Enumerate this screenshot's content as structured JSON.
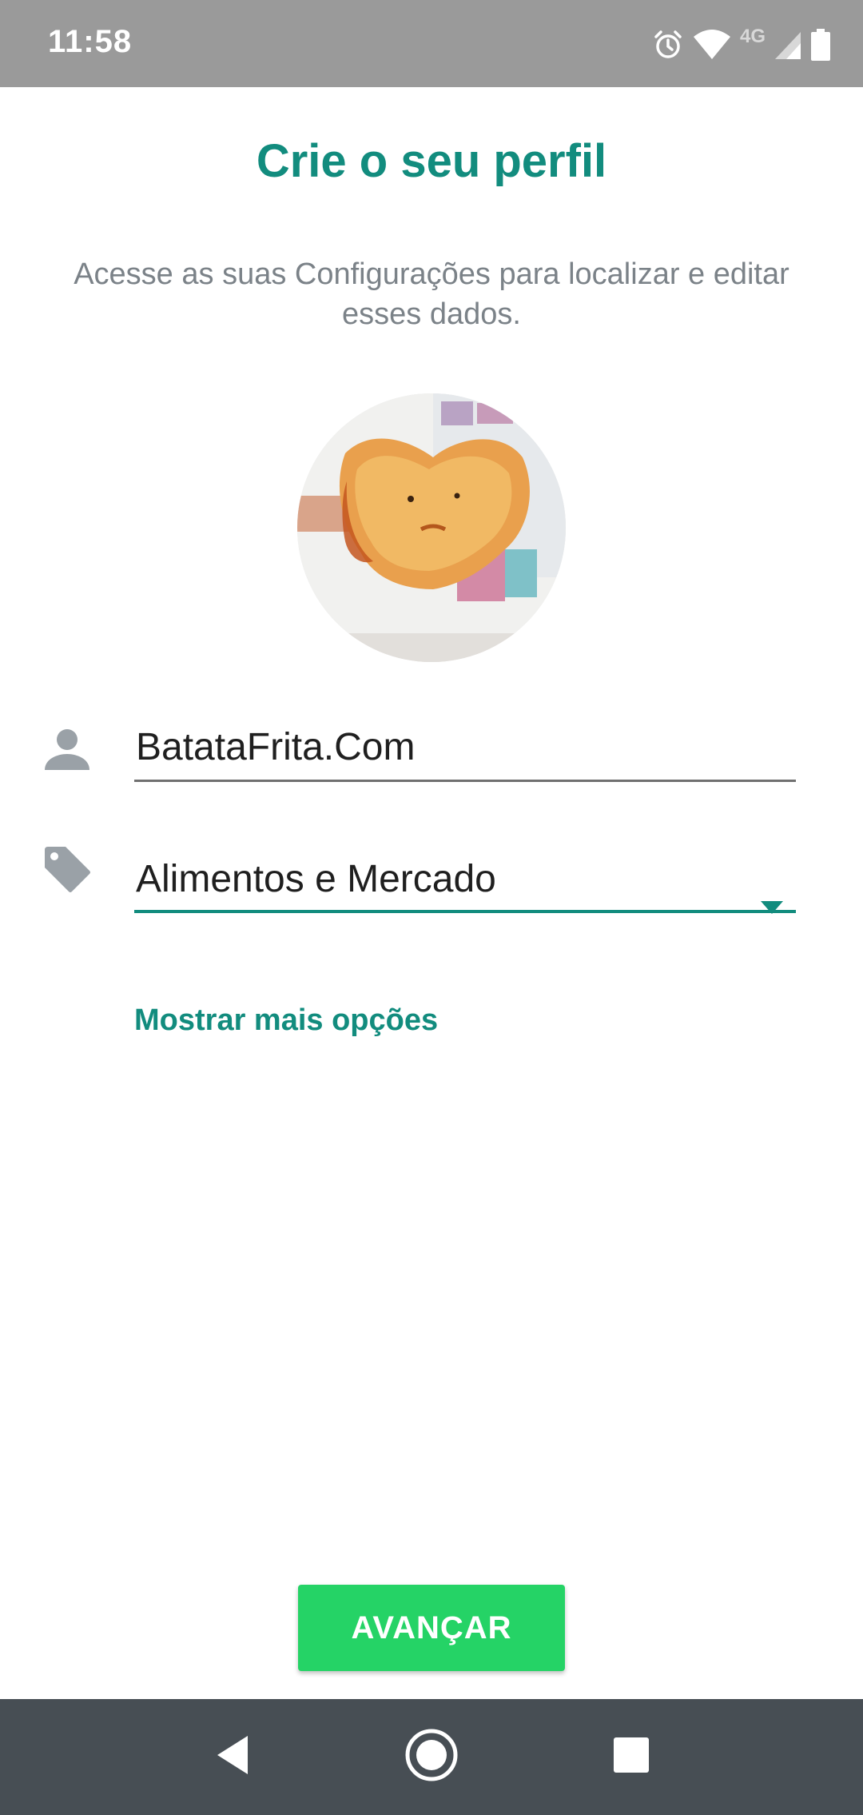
{
  "status_bar": {
    "time": "11:58",
    "network": "4G",
    "icons": [
      "alarm-icon",
      "wifi-icon",
      "signal-icon",
      "battery-icon"
    ]
  },
  "header": {
    "title": "Crie o seu perfil",
    "subtitle": "Acesse as suas Configurações para localizar e editar esses dados."
  },
  "profile": {
    "avatar": "profile-photo",
    "name_icon": "person-icon",
    "name_value": "BatataFrita.Com",
    "category_icon": "tag-icon",
    "category_value": "Alimentos e Mercado",
    "more_options_label": "Mostrar mais opções"
  },
  "actions": {
    "next_label": "AVANÇAR"
  },
  "nav_bar": {
    "buttons": [
      "back-icon",
      "home-icon",
      "recents-icon"
    ]
  },
  "colors": {
    "accent": "#128c7e",
    "button": "#25d366",
    "status_bar": "#9a9a9a",
    "nav_bar": "#474e54"
  }
}
